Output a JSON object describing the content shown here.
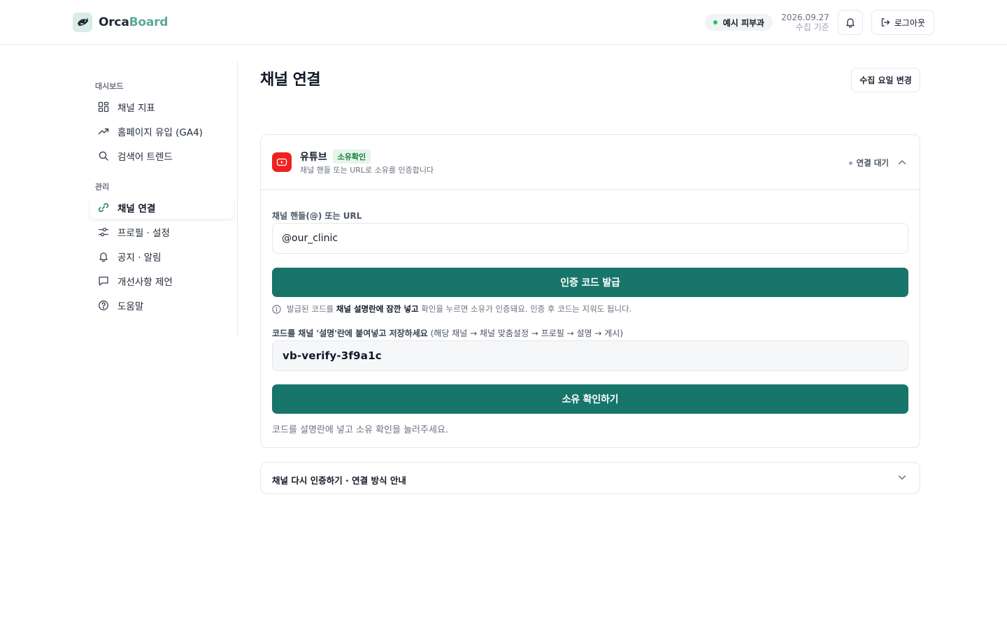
{
  "header": {
    "brand_a": "Orca",
    "brand_b": "Board",
    "clinic": "예시 피부과",
    "date": "2026.09.27",
    "date_sub": "수집 기준",
    "logout": "로그아웃"
  },
  "sidebar": {
    "section_dashboard": "대시보드",
    "section_manage": "관리",
    "items": [
      {
        "label": "채널 지표",
        "icon": "grid-icon"
      },
      {
        "label": "홈페이지 유입 (GA4)",
        "icon": "trend-icon"
      },
      {
        "label": "검색어 트렌드",
        "icon": "search-icon"
      },
      {
        "label": "채널 연결",
        "icon": "link-icon",
        "active": true
      },
      {
        "label": "프로필 · 설정",
        "icon": "sliders-icon"
      },
      {
        "label": "공지 · 알림",
        "icon": "bell-icon"
      },
      {
        "label": "개선사항 제언",
        "icon": "chat-icon"
      },
      {
        "label": "도움말",
        "icon": "help-icon"
      }
    ]
  },
  "main": {
    "title": "채널 연결",
    "schedule_button": "수집 요일 변경",
    "youtube": {
      "name": "유튜브",
      "badge": "소유확인",
      "subtitle": "채널 핸들 또는 URL로 소유를 인증합니다",
      "status": "연결 대기",
      "handle_label": "채널 핸들(@) 또는 URL",
      "handle_value": "@our_clinic",
      "issue_button": "인증 코드 발급",
      "hint_pre": "발급된 코드를 ",
      "hint_bold": "채널 설명란에 잠깐 넣고",
      "hint_post": " 확인을 누르면 소유가 인증돼요. 인증 후 코드는 지워도 됩니다.",
      "code_label_strong": "코드를 채널 '설명'란에 붙여넣고 저장하세요",
      "code_label_muted": " (해당 채널 → 채널 맞춤설정 → 프로필 → 설명 → 게시)",
      "code_value": "vb-verify-3f9a1c",
      "verify_button": "소유 확인하기",
      "footnote": "코드를 설명란에 넣고 소유 확인을 눌러주세요."
    },
    "reauth_title": "채널 다시 인증하기 · 연결 방식 안내"
  },
  "colors": {
    "accent": "#17756a",
    "brand_secondary": "#5ea79a",
    "youtube": "#ef2020",
    "status_green": "#22c55e"
  }
}
